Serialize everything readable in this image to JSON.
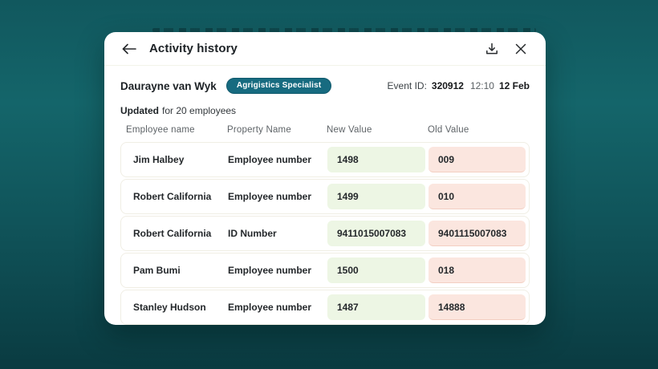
{
  "window": {
    "title": "Activity history"
  },
  "user": {
    "name": "Daurayne van Wyk",
    "role_badge": "Agrigistics Specialist"
  },
  "event": {
    "id_label": "Event ID:",
    "id": "320912",
    "time": "12:10",
    "date": "12 Feb",
    "action": "Updated",
    "action_scope": "for 20 employees"
  },
  "table": {
    "columns": {
      "employee": "Employee name",
      "property": "Property Name",
      "new_value": "New Value",
      "old_value": "Old Value"
    },
    "rows": [
      {
        "employee": "Jim Halbey",
        "property": "Employee number",
        "new_value": "1498",
        "old_value": "009"
      },
      {
        "employee": "Robert California",
        "property": "Employee number",
        "new_value": "1499",
        "old_value": "010"
      },
      {
        "employee": "Robert California",
        "property": "ID Number",
        "new_value": "9411015007083",
        "old_value": "9401115007083"
      },
      {
        "employee": "Pam Bumi",
        "property": "Employee number",
        "new_value": "1500",
        "old_value": "018"
      },
      {
        "employee": "Stanley Hudson",
        "property": "Employee number",
        "new_value": "1487",
        "old_value": "14888"
      }
    ]
  },
  "icons": {
    "back": "arrow-left",
    "download": "download-tray",
    "close": "x-mark"
  },
  "colors": {
    "badge_bg": "#176b80",
    "new_value_bg": "#edf6e4",
    "old_value_bg": "#fbe6df",
    "background_top": "#14656a",
    "background_bottom": "#0a3b41",
    "card_bg": "#ffffff"
  }
}
